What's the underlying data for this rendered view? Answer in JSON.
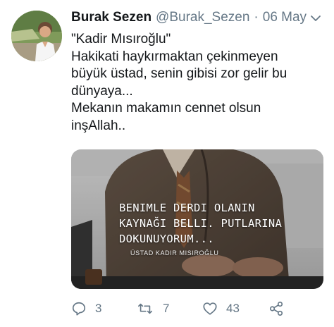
{
  "tweet": {
    "author_name": "Burak Sezen",
    "author_handle": "@Burak_Sezen",
    "separator": "·",
    "date": "06 May",
    "text_lines": [
      "\"Kadir Mısıroğlu\"",
      "Hakikati haykırmaktan çekinmeyen",
      "büyük üstad, senin gibisi zor gelir bu",
      "dünyaya...",
      "Mekanın makamın cennet olsun",
      "inşAllah.."
    ]
  },
  "media": {
    "quote_lines": [
      "BENIMLE DERDI OLANIN",
      "KAYNAĞI BELLI. PUTLARINA",
      "DOKUNUYORUM..."
    ],
    "attribution": "ÜSTAD KADIR MISIROĞLU"
  },
  "actions": {
    "reply_count": "3",
    "retweet_count": "7",
    "like_count": "43"
  },
  "icons": [
    "chevron-down-icon",
    "reply-icon",
    "retweet-icon",
    "like-icon",
    "share-icon"
  ],
  "colors": {
    "text": "#14171a",
    "muted": "#657786"
  }
}
